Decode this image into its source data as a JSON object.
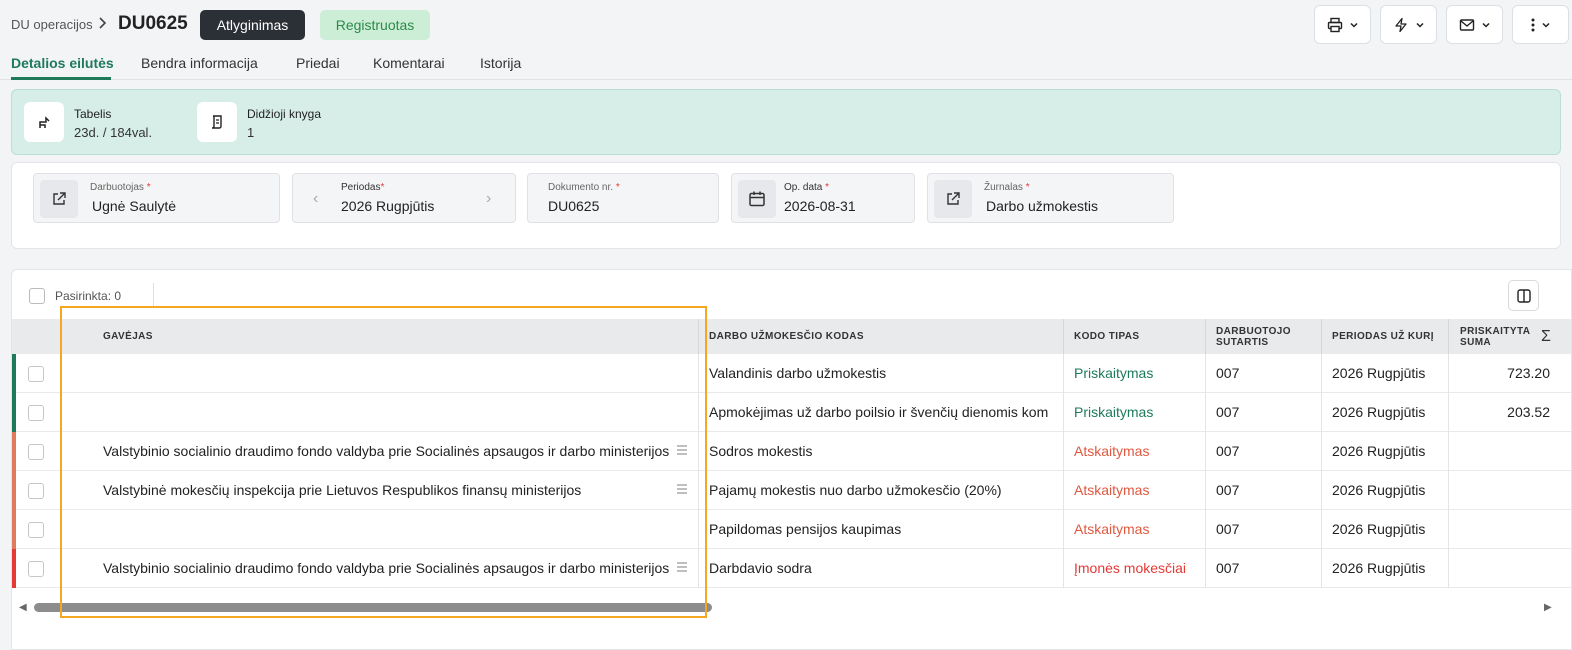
{
  "header": {
    "breadcrumb": "DU operacijos",
    "doc_number": "DU0625",
    "type_badge": "Atlyginimas",
    "status_badge": "Registruotas",
    "colors": {
      "accent": "#1f7a5a",
      "dark_badge": "#2b2f36",
      "status_green": "#cdeed6"
    }
  },
  "tabs": [
    {
      "label": "Detalios eilutės",
      "active": true
    },
    {
      "label": "Bendra informacija"
    },
    {
      "label": "Priedai"
    },
    {
      "label": "Komentarai"
    },
    {
      "label": "Istorija"
    }
  ],
  "summary": {
    "tabelis_label": "Tabelis",
    "tabelis_value": "23d. / 184val.",
    "ledger_label": "Didžioji knyga",
    "ledger_value": "1"
  },
  "fields": {
    "employee": {
      "label": "Darbuotojas",
      "value": "Ugnė Saulytė"
    },
    "period": {
      "label": "Periodas",
      "value": "2026 Rugpjūtis"
    },
    "doc_no": {
      "label": "Dokumento nr.",
      "value": "DU0625"
    },
    "op_date": {
      "label": "Op. data",
      "value": "2026-08-31"
    },
    "journal": {
      "label": "Žurnalas",
      "value": "Darbo užmokestis"
    }
  },
  "table": {
    "selected_label": "Pasirinkta: 0",
    "headers": {
      "recipient": "GAVĖJAS",
      "code": "DARBO UŽMOKESČIO KODAS",
      "code_type": "KODO TIPAS",
      "contract_1": "DARBUOTOJO",
      "contract_2": "SUTARTIS",
      "period": "PERIODAS UŽ KURĮ",
      "amount_1": "PRISKAITYTA",
      "amount_2": "SUMA",
      "sigma": "Σ"
    },
    "rows": [
      {
        "recipient": "",
        "code": "Valandinis darbo užmokestis",
        "type": "Priskaitymas",
        "contract": "007",
        "period": "2026 Rugpjūtis",
        "amount": "723.20"
      },
      {
        "recipient": "",
        "code": "Apmokėjimas už darbo poilsio ir švenčių dienomis kom",
        "type": "Priskaitymas",
        "contract": "007",
        "period": "2026 Rugpjūtis",
        "amount": "203.52"
      },
      {
        "recipient": "Valstybinio socialinio draudimo fondo valdyba prie Socialinės apsaugos ir darbo ministerijos",
        "code": "Sodros mokestis",
        "type": "Atskaitymas",
        "contract": "007",
        "period": "2026 Rugpjūtis",
        "amount": ""
      },
      {
        "recipient": "Valstybinė mokesčių inspekcija prie Lietuvos Respublikos finansų ministerijos",
        "code": "Pajamų mokestis nuo darbo užmokesčio (20%)",
        "type": "Atskaitymas",
        "contract": "007",
        "period": "2026 Rugpjūtis",
        "amount": ""
      },
      {
        "recipient": "",
        "code": "Papildomas pensijos kaupimas",
        "type": "Atskaitymas",
        "contract": "007",
        "period": "2026 Rugpjūtis",
        "amount": ""
      },
      {
        "recipient": "Valstybinio socialinio draudimo fondo valdyba prie Socialinės apsaugos ir darbo ministerijos",
        "code": "Darbdavio sodra",
        "type": "Įmonės mokesčiai",
        "contract": "007",
        "period": "2026 Rugpjūtis",
        "amount": ""
      }
    ],
    "type_colors": {
      "Priskaitymas": "#1f7a5a",
      "Atskaitymas": "#e0573f",
      "Įmonės mokesčiai": "#e53935"
    },
    "row_bar_colors": [
      "#1f7a5a",
      "#1f7a5a",
      "#e07a5f",
      "#e07a5f",
      "#e07a5f",
      "#e53935"
    ]
  }
}
